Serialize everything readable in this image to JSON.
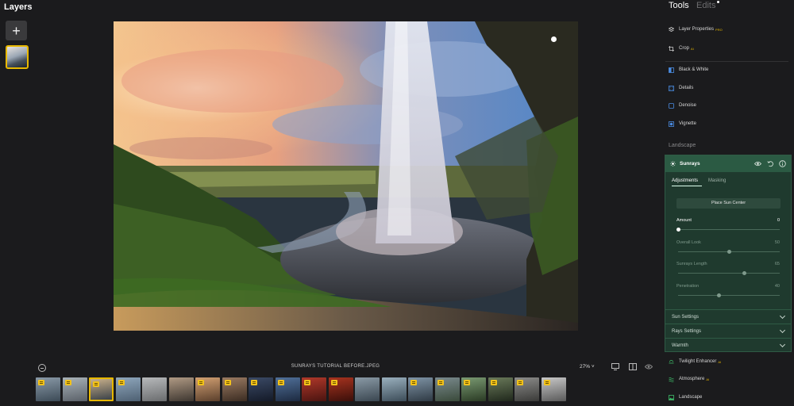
{
  "layers": {
    "title": "Layers",
    "add_label": "+"
  },
  "photo": {
    "filename": "SUNRAYS TUTORIAL BEFORE.JPEG"
  },
  "bottom_bar": {
    "zoom": "27% ˅",
    "icons": [
      "compare-icon",
      "monitor-icon",
      "split-view-icon",
      "eye-icon"
    ]
  },
  "filmstrip": {
    "selected_index": 2,
    "thumbs": [
      {
        "colors": [
          "#8a9aa8",
          "#3c4a56"
        ],
        "badge": true
      },
      {
        "colors": [
          "#a8b2b8",
          "#5a6068"
        ],
        "badge": true
      },
      {
        "colors": [
          "#c8b08a",
          "#3a4148"
        ],
        "badge": true
      },
      {
        "colors": [
          "#8fa7bd",
          "#4e6072"
        ],
        "badge": true
      },
      {
        "colors": [
          "#b7b9bb",
          "#6a6c6e"
        ],
        "badge": false
      },
      {
        "colors": [
          "#b09a84",
          "#3d3630"
        ],
        "badge": false
      },
      {
        "colors": [
          "#d2a072",
          "#5a3f2c"
        ],
        "badge": true
      },
      {
        "colors": [
          "#9a7a62",
          "#3b2c22"
        ],
        "badge": true
      },
      {
        "colors": [
          "#3b4a66",
          "#141a28"
        ],
        "badge": true
      },
      {
        "colors": [
          "#50709a",
          "#1d2a40"
        ],
        "badge": true
      },
      {
        "colors": [
          "#b0382a",
          "#4a1410"
        ],
        "badge": true
      },
      {
        "colors": [
          "#a8331f",
          "#3a0f0a"
        ],
        "badge": true
      },
      {
        "colors": [
          "#8a9aa6",
          "#3a4650"
        ],
        "badge": false
      },
      {
        "colors": [
          "#9ab0be",
          "#3c4c58"
        ],
        "badge": false
      },
      {
        "colors": [
          "#7f94a6",
          "#2f3a44"
        ],
        "badge": true
      },
      {
        "colors": [
          "#7a8a8e",
          "#3a4a3a"
        ],
        "badge": true
      },
      {
        "colors": [
          "#7a9a72",
          "#2a3a24"
        ],
        "badge": true
      },
      {
        "colors": [
          "#6a7a5a",
          "#20281c"
        ],
        "badge": true
      },
      {
        "colors": [
          "#8c8c8a",
          "#3a3a38"
        ],
        "badge": true
      },
      {
        "colors": [
          "#c8c8c8",
          "#5a5a5a"
        ],
        "badge": true
      }
    ]
  },
  "tabs": {
    "tools": "Tools",
    "edits": "Edits"
  },
  "tools": [
    {
      "label": "Layer Properties",
      "tag": "PRO",
      "icon": "layer-properties-icon"
    },
    {
      "label": "Crop",
      "tag": "AI",
      "icon": "crop-icon"
    }
  ],
  "essentials": [
    {
      "label": "Black & White",
      "icon": "black-white-icon"
    },
    {
      "label": "Details",
      "icon": "details-icon"
    },
    {
      "label": "Denoise",
      "icon": "denoise-icon"
    },
    {
      "label": "Vignette",
      "icon": "vignette-icon"
    }
  ],
  "section_title": "Landscape",
  "sunrays": {
    "title": "Sunrays",
    "tab_adjustments": "Adjustments",
    "tab_masking": "Masking",
    "place_sun_label": "Place Sun Center",
    "sliders": [
      {
        "label": "Amount",
        "value": "0",
        "fraction": 0.0,
        "active": true
      },
      {
        "label": "Overall Look",
        "value": "50",
        "fraction": 0.5,
        "active": false
      },
      {
        "label": "Sunrays Length",
        "value": "65",
        "fraction": 0.65,
        "active": false
      },
      {
        "label": "Penetration",
        "value": "40",
        "fraction": 0.4,
        "active": false
      }
    ],
    "sections": [
      "Sun Settings",
      "Rays Settings",
      "Warmth"
    ]
  },
  "landscape_tools": [
    {
      "label": "Twilight Enhancer",
      "tag": "AI",
      "icon": "twilight-icon"
    },
    {
      "label": "Atmosphere",
      "tag": "AI",
      "icon": "atmosphere-icon"
    },
    {
      "label": "Landscape",
      "icon": "landscape-icon"
    }
  ],
  "colors": {
    "accent": "#e8b800",
    "panel_green": "#1f3a2e",
    "header_green": "#2b5a43"
  }
}
